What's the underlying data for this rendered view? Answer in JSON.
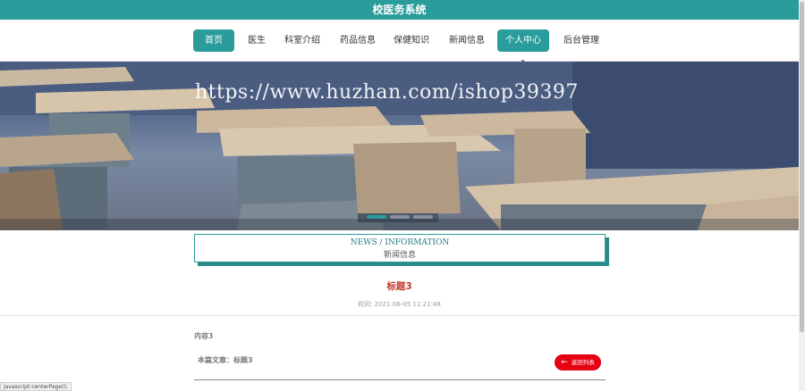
{
  "app_title": "校医务系统",
  "nav": {
    "items": [
      {
        "label": "首页",
        "active": true
      },
      {
        "label": "医生",
        "active": false
      },
      {
        "label": "科室介绍",
        "active": false
      },
      {
        "label": "药品信息",
        "active": false
      },
      {
        "label": "保健知识",
        "active": false
      },
      {
        "label": "新闻信息",
        "active": false
      },
      {
        "label": "个人中心",
        "active": true
      },
      {
        "label": "后台管理",
        "active": false
      }
    ]
  },
  "banner": {
    "watermark": "https://www.huzhan.com/ishop39397"
  },
  "section": {
    "title_en": "NEWS / INFORMATION",
    "title_cn": "新闻信息"
  },
  "article": {
    "title": "标题3",
    "time_label": "时间:",
    "time_value": "2021-06-05 11:21:48",
    "content": "内容3",
    "this_article": "本篇文章：标题3",
    "back_label": "返回列表"
  },
  "status_text": "javascript:centerPage();",
  "colors": {
    "primary": "#2a9c9c",
    "title_red": "#c0392b",
    "back_button": "#e60012"
  }
}
